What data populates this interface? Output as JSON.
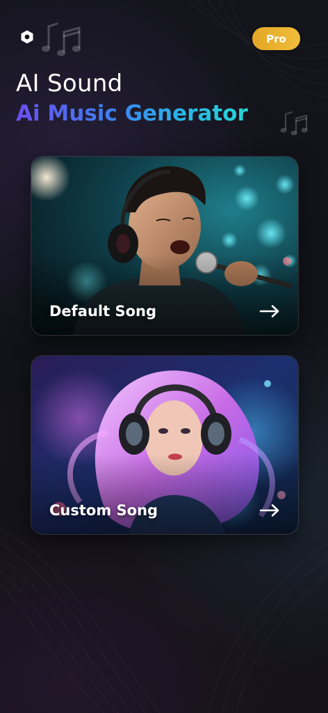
{
  "header": {
    "settings_icon": "hexagon-settings-icon",
    "pro_label": "Pro"
  },
  "hero": {
    "title": "AI Sound",
    "subtitle": "Ai Music Generator"
  },
  "cards": [
    {
      "label": "Default Song",
      "arrow_icon": "arrow-right-icon"
    },
    {
      "label": "Custom Song",
      "arrow_icon": "arrow-right-icon"
    }
  ],
  "colors": {
    "background": "#14141c",
    "pro_badge": "#e8ad2c",
    "subtitle_gradient_start": "#6a4ff2",
    "subtitle_gradient_end": "#27d6d3"
  }
}
